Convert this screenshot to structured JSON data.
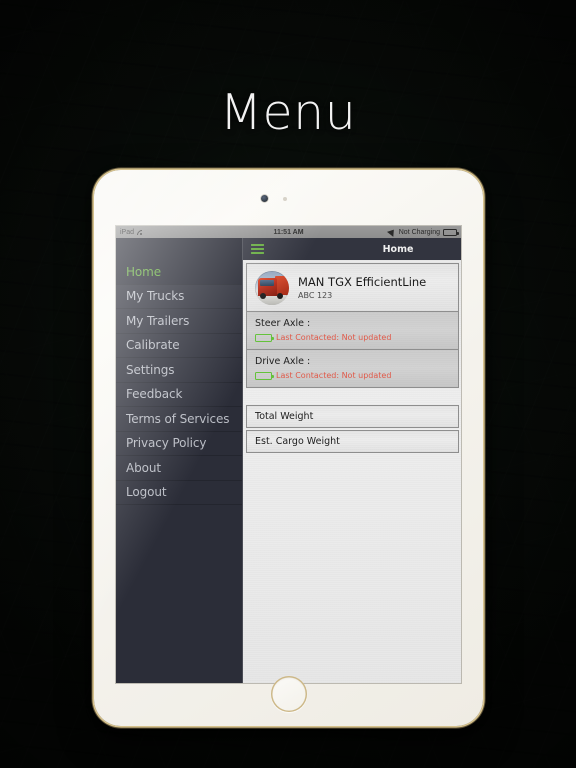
{
  "headline": "Menu",
  "status_bar": {
    "carrier": "iPad",
    "wifi_icon": "wifi-icon",
    "time": "11:51 AM",
    "location_icon": "location-arrow-icon",
    "charging_state": "Not Charging",
    "battery_icon": "battery-icon"
  },
  "navbar": {
    "menu_icon": "hamburger-menu-icon",
    "title": "Home"
  },
  "sidebar": {
    "items": [
      {
        "label": "Home",
        "active": true
      },
      {
        "label": "My Trucks",
        "active": false
      },
      {
        "label": "My Trailers",
        "active": false
      },
      {
        "label": "Calibrate",
        "active": false
      },
      {
        "label": "Settings",
        "active": false
      },
      {
        "label": "Feedback",
        "active": false
      },
      {
        "label": "Terms of Services",
        "active": false
      },
      {
        "label": "Privacy Policy",
        "active": false
      },
      {
        "label": "About",
        "active": false
      },
      {
        "label": "Logout",
        "active": false
      }
    ]
  },
  "main": {
    "truck": {
      "avatar_icon": "truck-photo-avatar",
      "name": "MAN TGX EfficientLine",
      "plate": "ABC 123"
    },
    "axles": [
      {
        "title": "Steer Axle :",
        "battery_icon": "battery-charging-icon",
        "status": "Last Contacted: Not updated"
      },
      {
        "title": "Drive Axle :",
        "battery_icon": "battery-charging-icon",
        "status": "Last Contacted: Not updated"
      }
    ],
    "weights": [
      {
        "label": "Total Weight"
      },
      {
        "label": "Est. Cargo Weight"
      }
    ]
  },
  "colors": {
    "accent_green": "#63ab3b",
    "status_red": "#e05a4a",
    "sidebar_bg": "#2b2d38",
    "navbar_bg": "#32343f",
    "battery_green": "#63c23a"
  }
}
